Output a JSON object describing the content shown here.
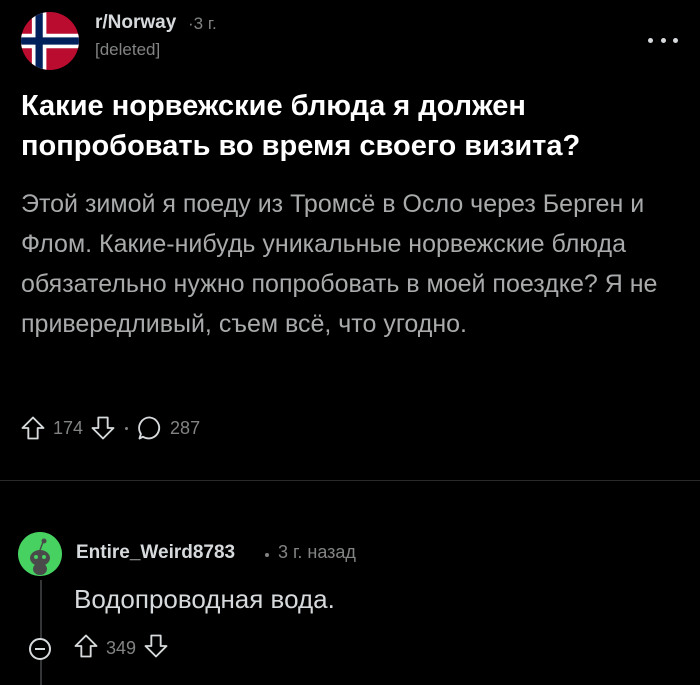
{
  "post": {
    "subreddit": "r/Norway",
    "age": "·3 г.",
    "author": "[deleted]",
    "title": "Какие норвежские блюда я должен попробовать во время своего визита?",
    "body": "Этой зимой я поеду из Тромсё в Осло через Берген и Флом. Какие-нибудь уникальные норвежские блюда обязательно нужно попробовать в моей поездке? Я не привередливый, съем всё, что угодно.",
    "upvotes": "174",
    "comments": "287"
  },
  "comment": {
    "author": "Entire_Weird8783",
    "time": "3 г. назад",
    "text": "Водопроводная вода.",
    "upvotes": "349"
  },
  "colors": {
    "flag_red": "#ba0c2f",
    "flag_blue": "#00205b",
    "avatar_green": "#46d160"
  },
  "icons": [
    "norway-flag-icon",
    "more-options-icon",
    "upvote-icon",
    "downvote-icon",
    "comment-icon",
    "snoo-avatar-icon",
    "collapse-icon"
  ]
}
